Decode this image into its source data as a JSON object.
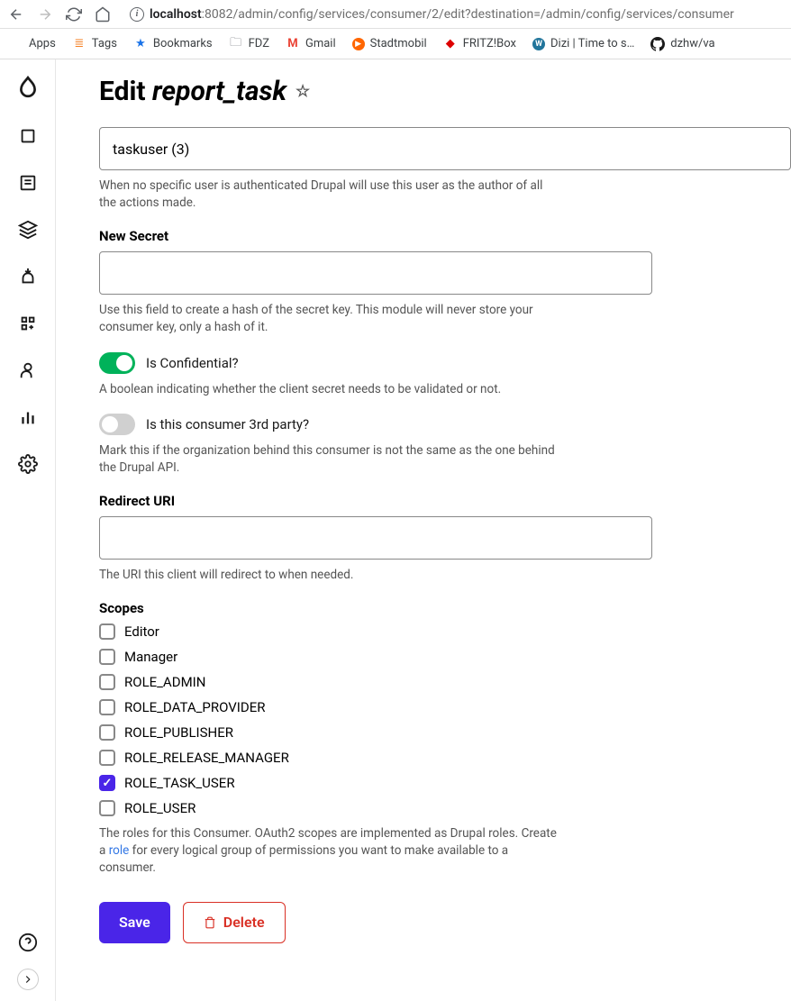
{
  "browser": {
    "url_host": "localhost",
    "url_path": ":8082/admin/config/services/consumer/2/edit?destination=/admin/config/services/consumer"
  },
  "bookmarks": [
    {
      "icon": "apps",
      "label": "Apps"
    },
    {
      "icon": "so",
      "label": "Tags"
    },
    {
      "icon": "star",
      "label": "Bookmarks"
    },
    {
      "icon": "folder",
      "label": "FDZ"
    },
    {
      "icon": "gmail",
      "label": "Gmail"
    },
    {
      "icon": "stadt",
      "label": "Stadtmobil"
    },
    {
      "icon": "fritz",
      "label": "FRITZ!Box"
    },
    {
      "icon": "wp",
      "label": "Dizi | Time to s…"
    },
    {
      "icon": "gh",
      "label": "dzhw/va"
    }
  ],
  "page": {
    "title_prefix": "Edit",
    "title_em": "report_task"
  },
  "form": {
    "user_value": "taskuser (3)",
    "user_help": "When no specific user is authenticated Drupal will use this user as the author of all the actions made.",
    "secret_label": "New Secret",
    "secret_help": "Use this field to create a hash of the secret key. This module will never store your consumer key, only a hash of it.",
    "confidential_label": "Is Confidential?",
    "confidential_help": "A boolean indicating whether the client secret needs to be validated or not.",
    "thirdparty_label": "Is this consumer 3rd party?",
    "thirdparty_help": "Mark this if the organization behind this consumer is not the same as the one behind the Drupal API.",
    "redirect_label": "Redirect URI",
    "redirect_help": "The URI this client will redirect to when needed.",
    "scopes_label": "Scopes",
    "scopes": [
      {
        "label": "Editor",
        "checked": false
      },
      {
        "label": "Manager",
        "checked": false
      },
      {
        "label": "ROLE_ADMIN",
        "checked": false
      },
      {
        "label": "ROLE_DATA_PROVIDER",
        "checked": false
      },
      {
        "label": "ROLE_PUBLISHER",
        "checked": false
      },
      {
        "label": "ROLE_RELEASE_MANAGER",
        "checked": false
      },
      {
        "label": "ROLE_TASK_USER",
        "checked": true
      },
      {
        "label": "ROLE_USER",
        "checked": false
      }
    ],
    "scopes_help_pre": "The roles for this Consumer. OAuth2 scopes are implemented as Drupal roles. Create a ",
    "scopes_help_link": "role",
    "scopes_help_post": " for every logical group of permissions you want to make available to a consumer.",
    "save_label": "Save",
    "delete_label": "Delete"
  }
}
